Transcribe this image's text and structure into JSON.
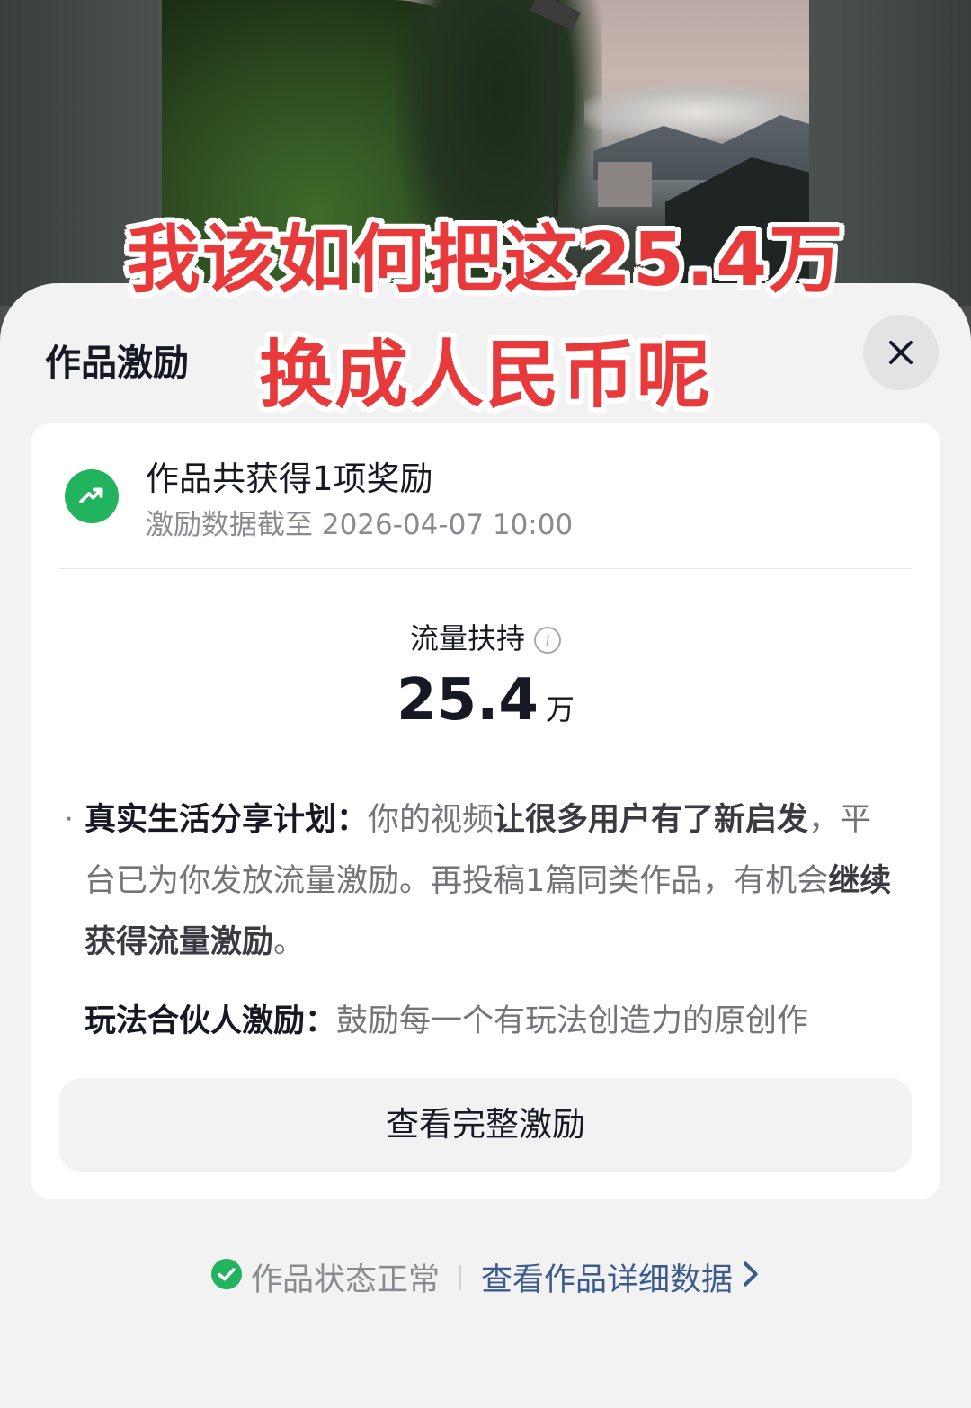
{
  "overlay": {
    "line1": "我该如何把这25.4万",
    "line2": "换成人民币呢"
  },
  "sheet": {
    "title": "作品激励",
    "close_icon": "close-icon"
  },
  "card": {
    "title": "作品共获得1项奖励",
    "subtitle": "激励数据截至 2026-04-07 10:00",
    "metric": {
      "label": "流量扶持",
      "value": "25.4",
      "unit": "万"
    },
    "items": [
      {
        "lead": "真实生活分享计划：",
        "t1": "你的视频",
        "b1": "让很多用户有了新启发",
        "t2": "，平台已为你发放流量激励。再投稿1篇同类作品，有机会",
        "b2": "继续获得流量激励",
        "t3": "。"
      },
      {
        "lead": "玩法合伙人激励：",
        "t1": "鼓励每一个有玩法创造力的原创作"
      }
    ],
    "full_button": "查看完整激励"
  },
  "footer": {
    "status": "作品状态正常",
    "link": "查看作品详细数据"
  },
  "colors": {
    "caption_red": "#e8393b",
    "accent_green": "#22b35e",
    "link_blue": "#3b5b8f"
  }
}
